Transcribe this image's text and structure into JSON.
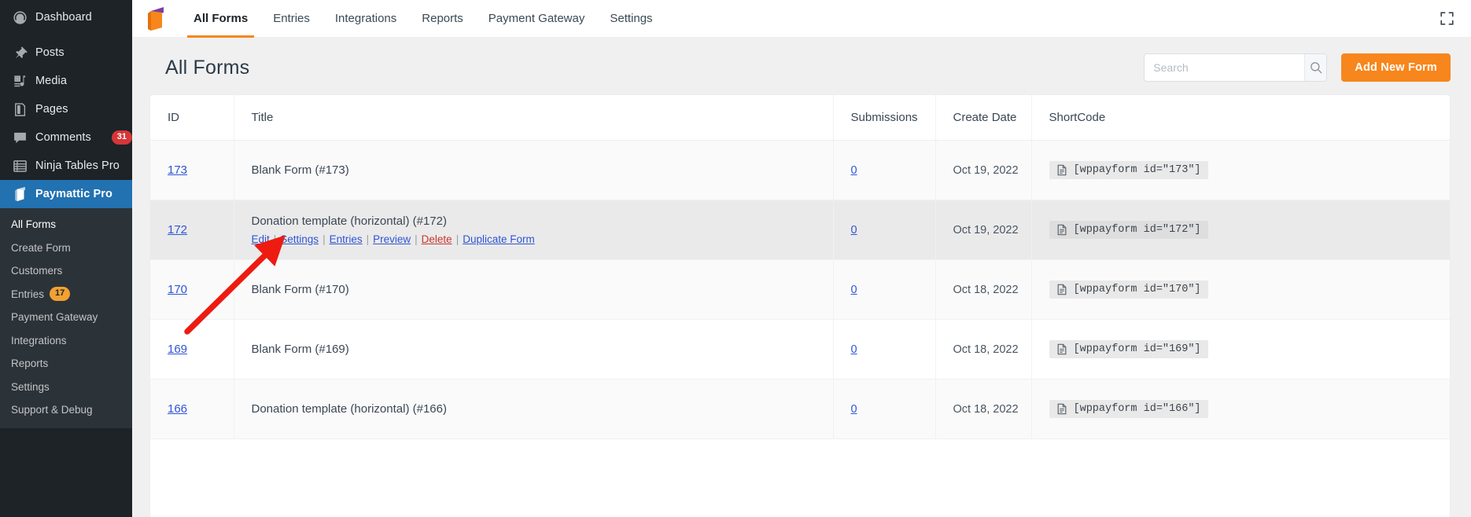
{
  "colors": {
    "accent_orange": "#f7861c",
    "sidebar_bg": "#1d2327",
    "submenu_bg": "#2c3338",
    "current_blue": "#2271b1",
    "link_blue": "#2f55d4",
    "delete_red": "#c9372c",
    "badge_red": "#d63638",
    "badge_amber": "#f0a132",
    "annotation_red": "#ee1b11"
  },
  "sidebar": {
    "items": [
      {
        "label": "Dashboard",
        "icon": "dashboard-icon",
        "badge": null,
        "current": false,
        "sep": false
      },
      {
        "label": "Posts",
        "icon": "pin-icon",
        "badge": null,
        "current": false,
        "sep": true
      },
      {
        "label": "Media",
        "icon": "media-icon",
        "badge": null,
        "current": false,
        "sep": false
      },
      {
        "label": "Pages",
        "icon": "pages-icon",
        "badge": null,
        "current": false,
        "sep": false
      },
      {
        "label": "Comments",
        "icon": "comment-icon",
        "badge": "31",
        "current": false,
        "sep": false
      },
      {
        "label": "Ninja Tables Pro",
        "icon": "table-icon",
        "badge": null,
        "current": false,
        "sep": false
      },
      {
        "label": "Paymattic Pro",
        "icon": "paymattic-icon",
        "badge": null,
        "current": true,
        "sep": false
      }
    ],
    "submenu": [
      {
        "label": "All Forms",
        "badge": null,
        "active": true
      },
      {
        "label": "Create Form",
        "badge": null,
        "active": false
      },
      {
        "label": "Customers",
        "badge": null,
        "active": false
      },
      {
        "label": "Entries",
        "badge": "17",
        "active": false
      },
      {
        "label": "Payment Gateway",
        "badge": null,
        "active": false
      },
      {
        "label": "Integrations",
        "badge": null,
        "active": false
      },
      {
        "label": "Reports",
        "badge": null,
        "active": false
      },
      {
        "label": "Settings",
        "badge": null,
        "active": false
      },
      {
        "label": "Support & Debug",
        "badge": null,
        "active": false
      }
    ]
  },
  "topbar": {
    "logo_name": "paymattic-logo",
    "tabs": [
      {
        "label": "All Forms",
        "active": true
      },
      {
        "label": "Entries",
        "active": false
      },
      {
        "label": "Integrations",
        "active": false
      },
      {
        "label": "Reports",
        "active": false
      },
      {
        "label": "Payment Gateway",
        "active": false
      },
      {
        "label": "Settings",
        "active": false
      }
    ],
    "fullscreen_icon": "fullscreen-expand-icon"
  },
  "header": {
    "title": "All Forms",
    "search_placeholder": "Search",
    "search_value": "",
    "search_icon": "search-icon",
    "add_button_label": "Add New Form"
  },
  "table": {
    "columns": [
      "ID",
      "Title",
      "Submissions",
      "Create Date",
      "ShortCode"
    ],
    "rows": [
      {
        "id": "173",
        "title": "Blank Form (#173)",
        "submissions": "0",
        "create_date": "Oct 19, 2022",
        "shortcode": "[wppayform id=\"173\"]",
        "hovered": false,
        "stripe": "row-stripe"
      },
      {
        "id": "172",
        "title": "Donation template (horizontal) (#172)",
        "submissions": "0",
        "create_date": "Oct 19, 2022",
        "shortcode": "[wppayform id=\"172\"]",
        "hovered": true,
        "stripe": "row-hover"
      },
      {
        "id": "170",
        "title": "Blank Form (#170)",
        "submissions": "0",
        "create_date": "Oct 18, 2022",
        "shortcode": "[wppayform id=\"170\"]",
        "hovered": false,
        "stripe": "row-stripe"
      },
      {
        "id": "169",
        "title": "Blank Form (#169)",
        "submissions": "0",
        "create_date": "Oct 18, 2022",
        "shortcode": "[wppayform id=\"169\"]",
        "hovered": false,
        "stripe": "row-plain"
      },
      {
        "id": "166",
        "title": "Donation template (horizontal) (#166)",
        "submissions": "0",
        "create_date": "Oct 18, 2022",
        "shortcode": "[wppayform id=\"166\"]",
        "hovered": false,
        "stripe": "row-stripe"
      }
    ],
    "row_actions": {
      "edit": "Edit",
      "settings": "Settings",
      "entries": "Entries",
      "preview": "Preview",
      "delete": "Delete",
      "duplicate": "Duplicate Form",
      "separator": "|"
    },
    "shortcode_icon": "copy-document-icon"
  },
  "annotation": {
    "type": "arrow",
    "points_to": "Edit",
    "color": "#ee1b11"
  }
}
